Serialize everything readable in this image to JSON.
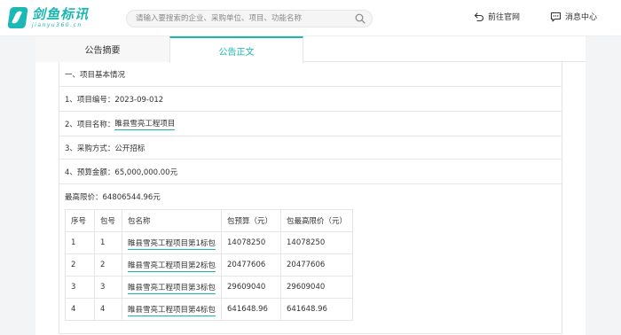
{
  "header": {
    "logo_cn": "剑鱼标讯",
    "logo_en": "jianyu360.cn",
    "search_placeholder": "请输入要搜索的企业、采购单位、项目、功能名称",
    "official_site": "前往官网",
    "message_center": "消息中心"
  },
  "tabs": [
    {
      "label": "公告摘要",
      "active": false
    },
    {
      "label": "公告正文",
      "active": true
    }
  ],
  "document": {
    "section_title": "一、项目基本情况",
    "project_no": "1、项目编号：2023-09-012",
    "project_name_prefix": "2、项目名称：",
    "project_name": "睢县雪亮工程项目",
    "procurement_method": "3、采购方式：公开招标",
    "budget": "4、预算金额：65,000,000.00元",
    "max_price": "最高限价：64806544.96元"
  },
  "packages_table": {
    "headers": [
      "序号",
      "包号",
      "包名称",
      "包预算（元）",
      "包最高限价（元）"
    ],
    "rows": [
      [
        "1",
        "1",
        "睢县雪亮工程项目第1标包",
        "14078250",
        "14078250"
      ],
      [
        "2",
        "2",
        "睢县雪亮工程项目第2标包",
        "20477606",
        "20477606"
      ],
      [
        "3",
        "3",
        "睢县雪亮工程项目第3标包",
        "29609040",
        "29609040"
      ],
      [
        "4",
        "4",
        "睢县雪亮工程项目第4标包",
        "641648.96",
        "641648.96"
      ]
    ]
  },
  "colors": {
    "accent": "#18b7b2",
    "border": "#e6e6e6",
    "background": "#f3f4f6"
  },
  "icons": {
    "search": "search-icon",
    "official": "return-arrow-icon",
    "message": "chat-bubble-icon",
    "logo": "swordfish-logo-icon"
  }
}
